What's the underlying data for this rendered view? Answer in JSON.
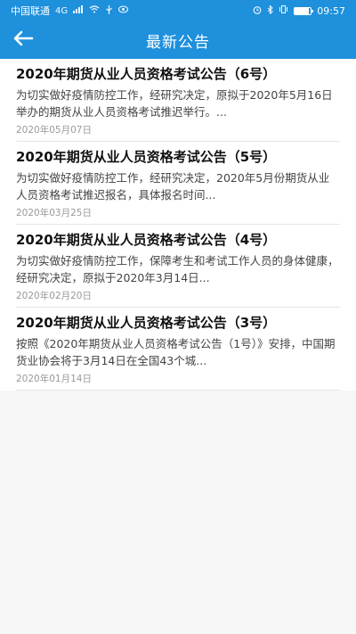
{
  "status_bar": {
    "carrier": "中国联通",
    "network": "4G",
    "time": "09:57",
    "battery_level": 0.85
  },
  "app_bar": {
    "title": "最新公告"
  },
  "announcements": [
    {
      "title": "2020年期货从业人员资格考试公告（6号）",
      "summary": "为切实做好疫情防控工作，经研究决定，原拟于2020年5月16日举办的期货从业人员资格考试推迟举行。...",
      "date": "2020年05月07日"
    },
    {
      "title": "2020年期货从业人员资格考试公告（5号）",
      "summary": "为切实做好疫情防控工作，经研究决定，2020年5月份期货从业人员资格考试推迟报名，具体报名时间...",
      "date": "2020年03月25日"
    },
    {
      "title": "2020年期货从业人员资格考试公告（4号）",
      "summary": "为切实做好疫情防控工作，保障考生和考试工作人员的身体健康，经研究决定，原拟于2020年3月14日...",
      "date": "2020年02月20日"
    },
    {
      "title": "2020年期货从业人员资格考试公告（3号）",
      "summary": "按照《2020年期货从业人员资格考试公告（1号）》安排，中国期货业协会将于3月14日在全国43个城...",
      "date": "2020年01月14日"
    }
  ]
}
